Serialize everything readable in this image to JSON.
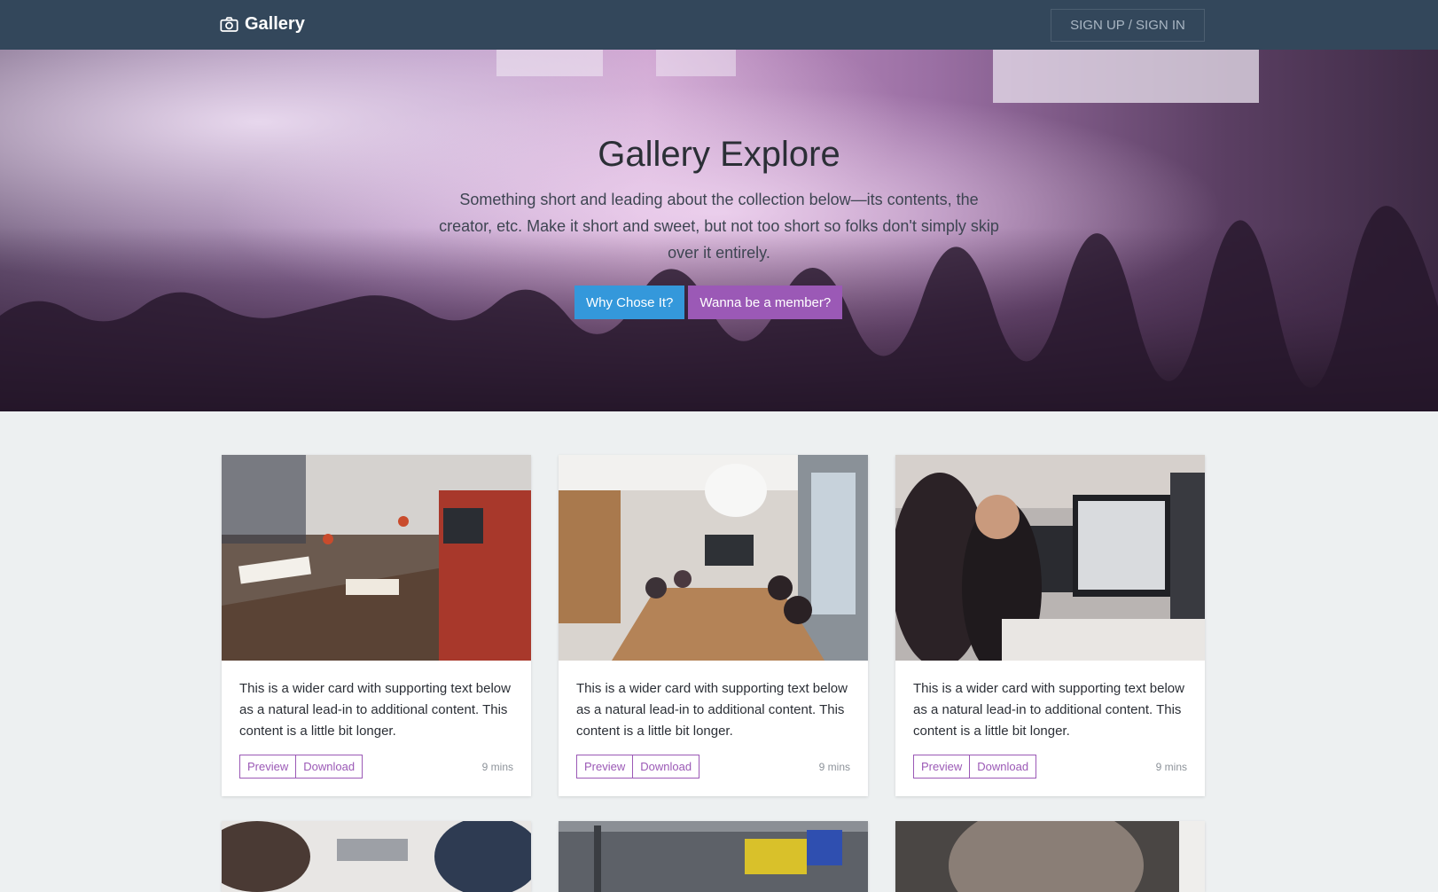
{
  "navbar": {
    "brand": "Gallery",
    "brand_icon": "camera-icon",
    "signup_label": "SIGN UP / SIGN IN",
    "bg_color": "#33475b"
  },
  "hero": {
    "title": "Gallery Explore",
    "lead": "Something short and leading about the collection below—its contents, the creator, etc. Make it short and sweet, but not too short so folks don't simply skip over it entirely.",
    "primary_button": "Why Chose It?",
    "secondary_button": "Wanna be a member?",
    "primary_color": "#3498db",
    "secondary_color": "#9b59b6"
  },
  "cards": [
    {
      "text": "This is a wider card with supporting text below as a natural lead-in to additional content. This content is a little bit longer.",
      "preview": "Preview",
      "download": "Download",
      "meta": "9 mins"
    },
    {
      "text": "This is a wider card with supporting text below as a natural lead-in to additional content. This content is a little bit longer.",
      "preview": "Preview",
      "download": "Download",
      "meta": "9 mins"
    },
    {
      "text": "This is a wider card with supporting text below as a natural lead-in to additional content. This content is a little bit longer.",
      "preview": "Preview",
      "download": "Download",
      "meta": "9 mins"
    }
  ],
  "colors": {
    "page_bg": "#edf0f1",
    "accent": "#9b59b6"
  }
}
